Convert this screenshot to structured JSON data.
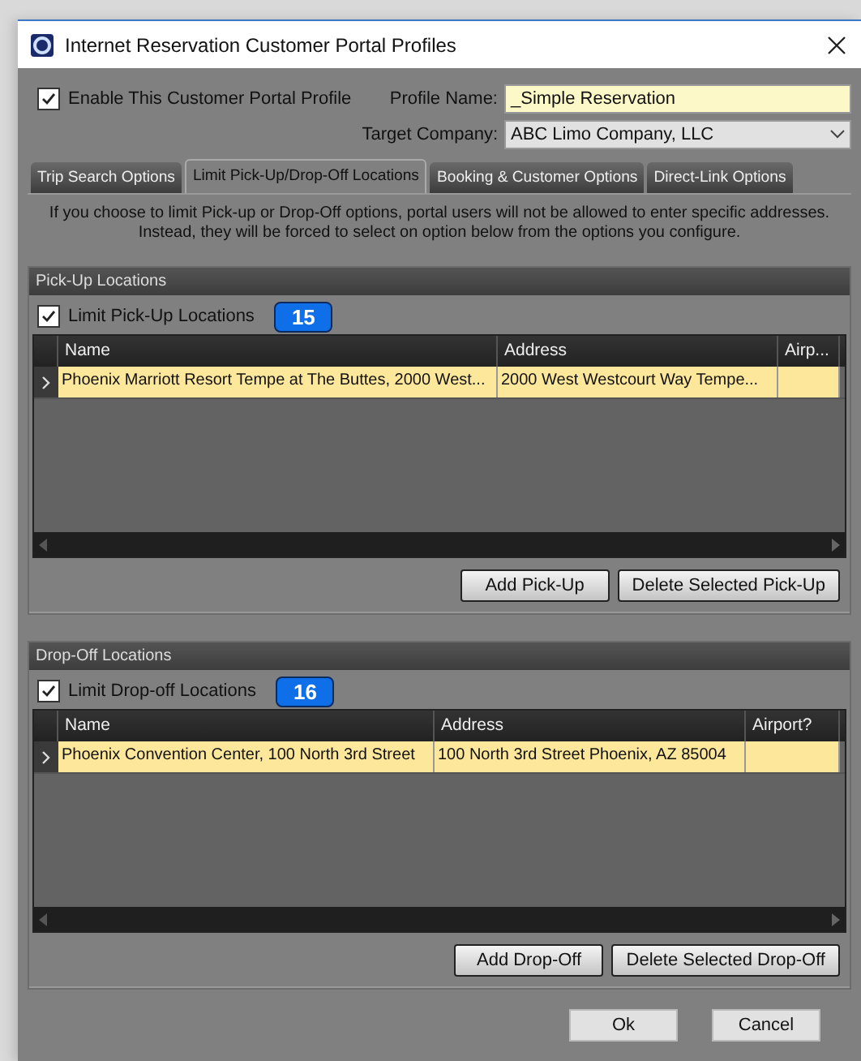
{
  "window": {
    "title": "Internet Reservation Customer Portal Profiles"
  },
  "enable_profile": {
    "label": "Enable This Customer Portal Profile",
    "checked": true
  },
  "profile_name": {
    "label": "Profile Name:",
    "value": "_Simple Reservation"
  },
  "target_company": {
    "label": "Target Company:",
    "value": "ABC Limo Company, LLC"
  },
  "tabs": [
    {
      "label": "Trip Search Options",
      "selected": false
    },
    {
      "label": "Limit Pick-Up/Drop-Off Locations",
      "selected": true
    },
    {
      "label": "Booking & Customer Options",
      "selected": false
    },
    {
      "label": "Direct-Link Options",
      "selected": false
    }
  ],
  "info_lines": [
    "If you choose to limit Pick-up or Drop-Off options, portal users will not be allowed to enter specific addresses.",
    "Instead, they will be forced to select on option below from the options you configure."
  ],
  "sections": [
    {
      "title": "Pick-Up Locations",
      "limit": {
        "label": "Limit Pick-Up Locations",
        "checked": true
      },
      "callout": "15",
      "columns": [
        "Name",
        "Address",
        "Airp..."
      ],
      "rows": [
        {
          "cells": [
            "Phoenix Marriott Resort Tempe at The Buttes, 2000 West...",
            "2000 West Westcourt Way Tempe...",
            ""
          ],
          "selected": true
        }
      ],
      "buttons": [
        "Add Pick-Up",
        "Delete Selected Pick-Up"
      ]
    },
    {
      "title": "Drop-Off Locations",
      "limit": {
        "label": "Limit Drop-off Locations",
        "checked": true
      },
      "callout": "16",
      "columns": [
        "Name",
        "Address",
        "Airport?"
      ],
      "rows": [
        {
          "cells": [
            "Phoenix Convention Center, 100 North 3rd Street",
            "100 North 3rd Street Phoenix, AZ 85004",
            ""
          ],
          "selected": true
        }
      ],
      "buttons": [
        "Add Drop-Off",
        "Delete Selected Drop-Off"
      ]
    }
  ],
  "dialog_buttons": [
    "Ok",
    "Cancel"
  ]
}
